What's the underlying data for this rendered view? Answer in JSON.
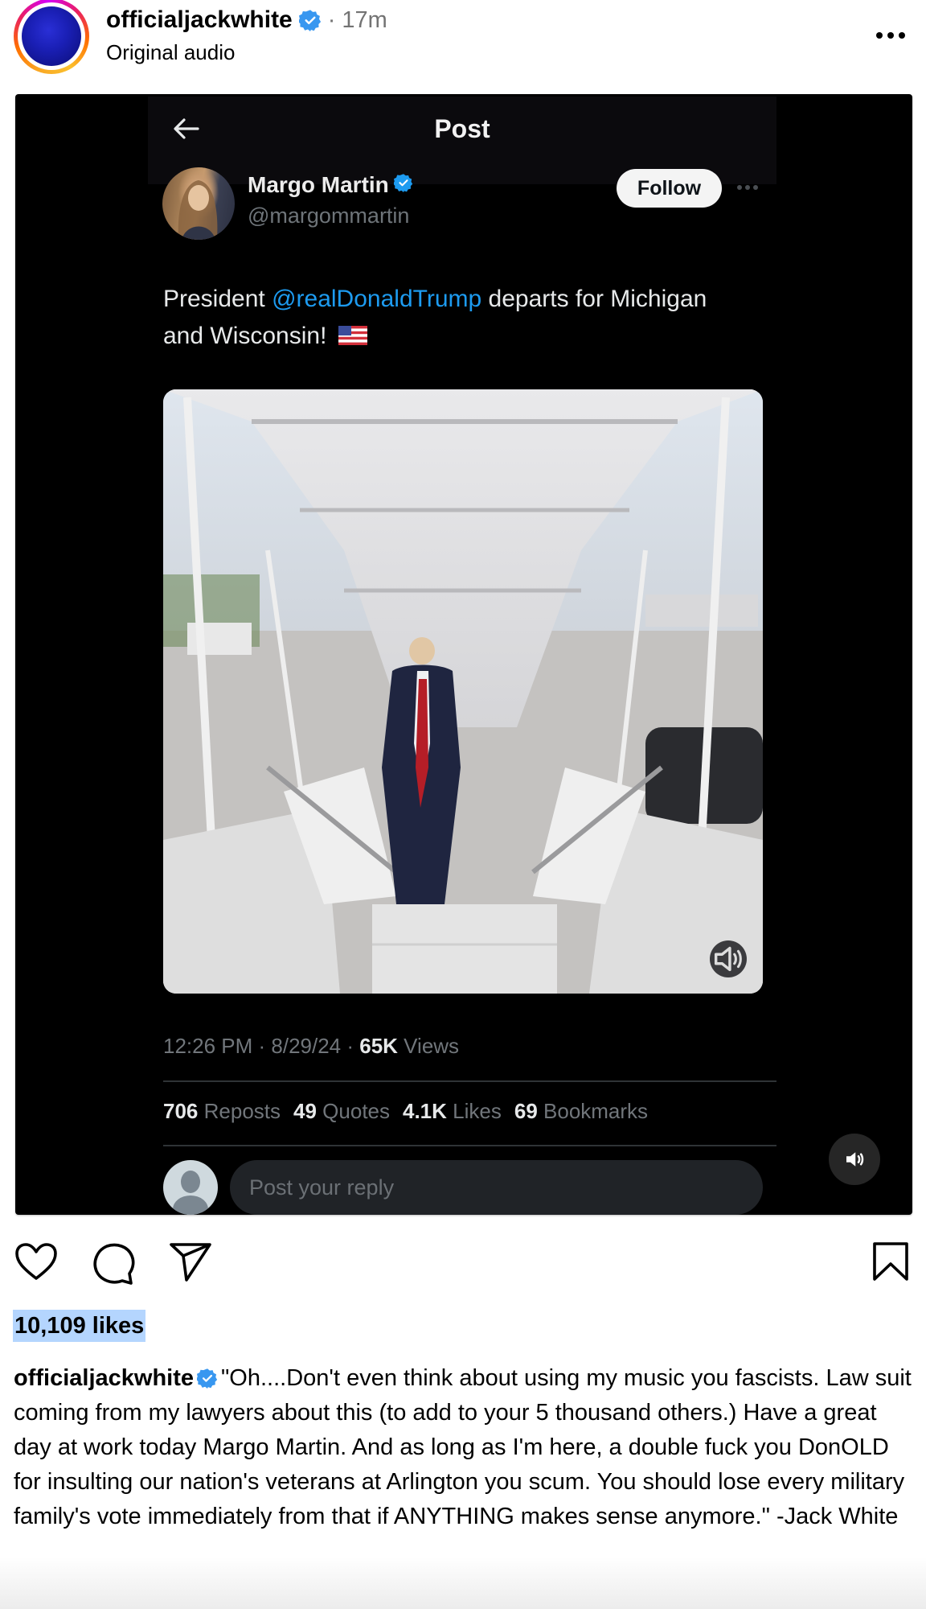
{
  "post_header": {
    "username": "officialjackwhite",
    "separator": "·",
    "time_ago": "17m",
    "audio_label": "Original audio",
    "verified": true
  },
  "embedded_tweet": {
    "screen_title": "Post",
    "author_name": "Margo Martin",
    "author_handle": "@margommartin",
    "follow_label": "Follow",
    "text_before": "President ",
    "mention": "@realDonaldTrump",
    "text_after": " departs for Michigan and Wisconsin!",
    "flag_emoji": "🇺🇸",
    "timestamp": "12:26 PM · 8/29/24 · ",
    "views_count": "65K",
    "views_label": " Views",
    "stats": [
      {
        "count": "706",
        "label": "Reposts"
      },
      {
        "count": "49",
        "label": "Quotes"
      },
      {
        "count": "4.1K",
        "label": "Likes"
      },
      {
        "count": "69",
        "label": "Bookmarks"
      }
    ],
    "reply_placeholder": "Post your reply",
    "mention_color": "#1d9bf0"
  },
  "actions": {
    "like": "heart-icon",
    "comment": "comment-icon",
    "share": "send-icon",
    "save": "bookmark-icon"
  },
  "likes_text": "10,109 likes",
  "caption": {
    "username": "officialjackwhite",
    "text": "\"Oh....Don't even think about using my music you fascists. Law suit coming from my lawyers about this (to add to your 5 thousand others.) Have a great day at work today Margo Martin. And as long as I'm here, a double fuck you DonOLD for insulting our nation's veterans at Arlington you scum. You should lose every military family's vote immediately from that if ANYTHING makes sense anymore.\" -Jack White"
  },
  "colors": {
    "verified_blue": "#3897f0",
    "likes_highlight": "#b4d5fe",
    "panel_bg": "#000000"
  }
}
